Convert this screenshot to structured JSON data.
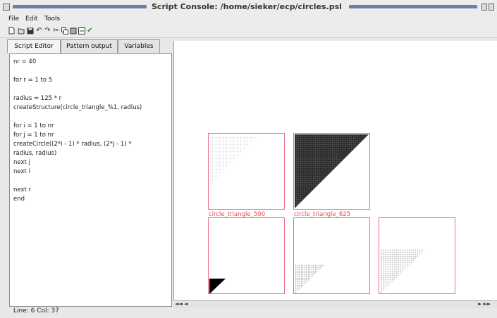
{
  "window": {
    "title": "Script Console: /home/sieker/ecp/circles.psl"
  },
  "menu": {
    "items": [
      "File",
      "Edit",
      "Tools"
    ]
  },
  "toolbar": {
    "icons": [
      "new-file-icon",
      "open-file-icon",
      "save-icon",
      "undo-icon",
      "redo-icon",
      "cut-icon",
      "copy-icon",
      "paste-icon",
      "clear-icon",
      "run-check-icon"
    ]
  },
  "tabs": [
    {
      "label": "Script Editor",
      "active": true
    },
    {
      "label": "Pattern output",
      "active": false
    },
    {
      "label": "Variables",
      "active": false
    }
  ],
  "editor": {
    "lines": [
      "nr =  40",
      "",
      "for r = 1 to 5",
      "",
      "radius = 125 * r",
      "createStructure(circle_triangle_%1, radius)",
      "",
      "for i = 1 to nr",
      "for j = 1 to nr",
      "createCircle((2*i - 1) * radius, (2*j - 1) *",
      "radius, radius)",
      "next j",
      "next i",
      "",
      "next r",
      "end"
    ]
  },
  "status": {
    "text": "Line: 6  Col: 37"
  },
  "patterns": [
    {
      "label": "circle_triangle_500",
      "style": "light-grid"
    },
    {
      "label": "circle_triangle_625",
      "style": "dark-grid"
    },
    {
      "label": "",
      "style": "tiny-black"
    },
    {
      "label": "",
      "style": "small-grey"
    },
    {
      "label": "",
      "style": "medium-grey"
    }
  ],
  "nav": {
    "left": "◄◄ ◄",
    "right": "► ►►"
  },
  "colors": {
    "pattern_border": "#ef6a86",
    "label_text": "#e24a4a",
    "titlebar_stripe": "#6d7fa9"
  }
}
